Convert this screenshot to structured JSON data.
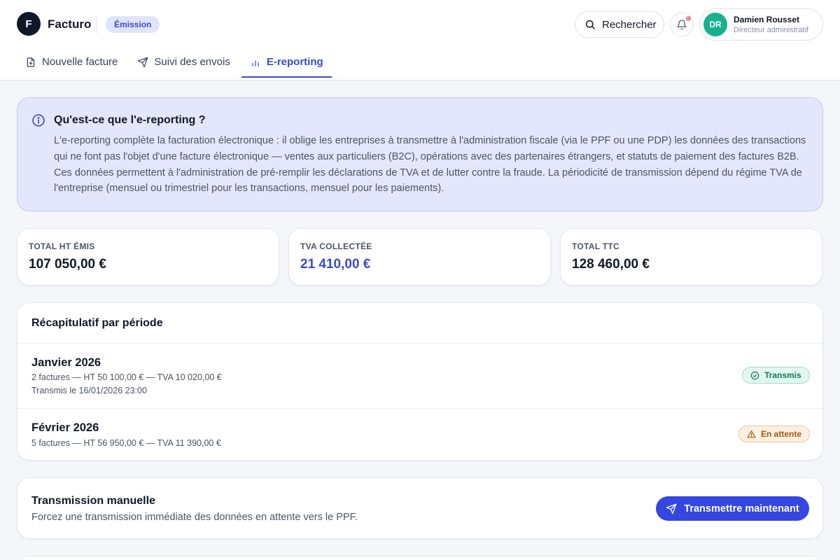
{
  "app": {
    "logo_letter": "F",
    "name": "Facturo",
    "mode_badge": "Émission"
  },
  "header": {
    "search_label": "Rechercher",
    "notifications_unread": true,
    "user": {
      "initials": "DR",
      "name": "Damien Rousset",
      "role": "Directeur administratif"
    }
  },
  "tabs": [
    {
      "label": "Nouvelle facture",
      "icon": "file-plus-icon",
      "active": false
    },
    {
      "label": "Suivi des envois",
      "icon": "send-icon",
      "active": false
    },
    {
      "label": "E-reporting",
      "icon": "bar-chart-icon",
      "active": true
    }
  ],
  "info": {
    "title": "Qu'est-ce que l'e-reporting ?",
    "body": "L'e-reporting complète la facturation électronique : il oblige les entreprises à transmettre à l'administration fiscale (via le PPF ou une PDP) les données des transactions qui ne font pas l'objet d'une facture électronique — ventes aux particuliers (B2C), opérations avec des partenaires étrangers, et statuts de paiement des factures B2B. Ces données permettent à l'administration de pré-remplir les déclarations de TVA et de lutter contre la fraude. La périodicité de transmission dépend du régime TVA de l'entreprise (mensuel ou trimestriel pour les transactions, mensuel pour les paiements)."
  },
  "kpis": [
    {
      "label": "TOTAL HT ÉMIS",
      "value": "107 050,00 €"
    },
    {
      "label": "TVA COLLECTÉE",
      "value": "21 410,00 €",
      "accent": true
    },
    {
      "label": "TOTAL TTC",
      "value": "128 460,00 €"
    }
  ],
  "recap": {
    "title": "Récapitulatif par période",
    "periods": [
      {
        "name": "Janvier 2026",
        "summary": "2 factures — HT 50 100,00 € — TVA 10 020,00 €",
        "transmitted": "Transmis le 16/01/2026 23:00",
        "status": "Transmis"
      },
      {
        "name": "Février 2026",
        "summary": "5 factures — HT 56 950,00 € — TVA 11 390,00 €",
        "status": "En attente"
      }
    ]
  },
  "transmission": {
    "title": "Transmission manuelle",
    "description": "Forcez une transmission immédiate des données en attente vers le PPF.",
    "button_label": "Transmettre maintenant"
  },
  "colors": {
    "accent": "#3a4bcf",
    "button": "#3547e0",
    "success": "#0f7a57",
    "warning": "#a05a10",
    "avatar": "#16b28f"
  }
}
